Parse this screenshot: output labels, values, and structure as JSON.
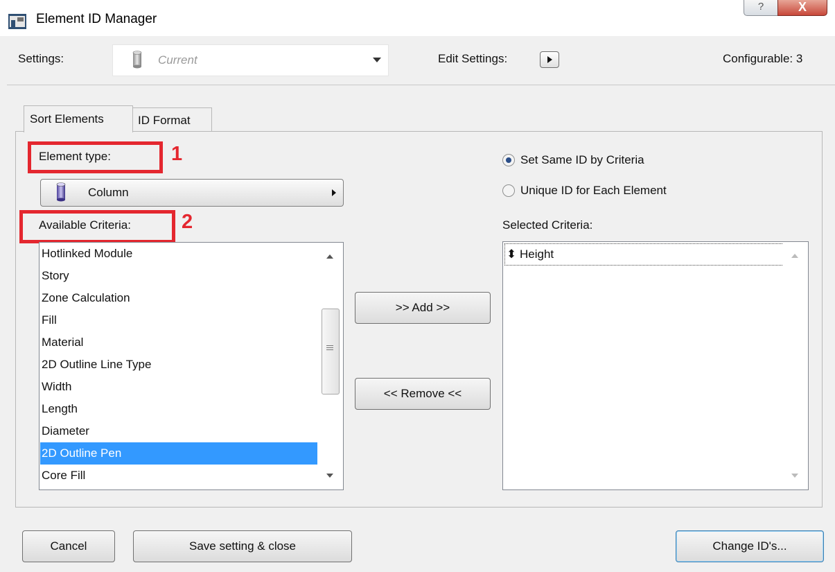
{
  "window": {
    "title": "Element ID Manager",
    "help_glyph": "?",
    "close_glyph": "X"
  },
  "header": {
    "settings_label": "Settings:",
    "settings_value": "Current",
    "edit_settings_label": "Edit Settings:",
    "configurable_label": "Configurable: 3"
  },
  "tabs": [
    {
      "label": "Sort Elements",
      "active": true
    },
    {
      "label": "ID Format",
      "active": false
    }
  ],
  "sort_elements": {
    "element_type_label": "Element type:",
    "element_type_value": "Column",
    "available_criteria_label": "Available Criteria:",
    "annotation_1": "1",
    "annotation_2": "2",
    "available_criteria": [
      "Hotlinked Module",
      "Story",
      "Zone Calculation",
      "Fill",
      "Material",
      "2D Outline Line Type",
      "Width",
      "Length",
      "Diameter",
      "2D Outline Pen",
      "Core Fill"
    ],
    "selected_available_index": 9,
    "add_button": ">> Add >>",
    "remove_button": "<< Remove <<",
    "radio_options": [
      {
        "label": "Set Same ID by Criteria",
        "checked": true
      },
      {
        "label": "Unique ID for Each Element",
        "checked": false
      }
    ],
    "selected_criteria_label": "Selected Criteria:",
    "selected_criteria": [
      {
        "sort_glyph": "⬍",
        "label": "Height"
      }
    ]
  },
  "footer": {
    "cancel_button": "Cancel",
    "save_button": "Save setting & close",
    "change_ids_button": "Change ID's..."
  },
  "colors": {
    "annotation_red": "#e4272f",
    "selection_blue": "#3399ff",
    "radio_dot": "#2b4e88"
  }
}
